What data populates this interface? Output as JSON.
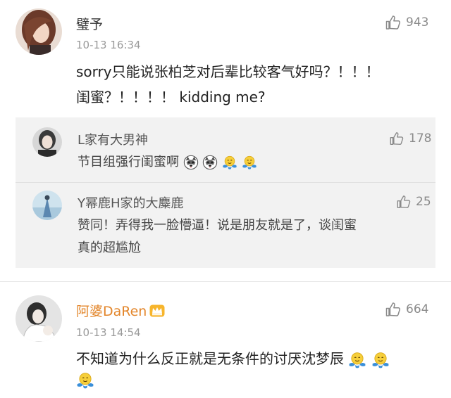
{
  "comments": [
    {
      "username": "璧予",
      "timestamp": "10-13 16:34",
      "likes": "943",
      "text_line1": "sorry只能说张柏芝对后辈比较客气好吗？！！！",
      "text_line2": "闺蜜？！！！！ kidding me?"
    },
    {
      "username": "阿婆DaRen",
      "timestamp": "10-13 14:54",
      "likes": "664",
      "text_line1": "不知道为什么反正就是无条件的讨厌沈梦辰"
    }
  ],
  "replies": [
    {
      "username": "L家有大男神",
      "likes": "178",
      "text": "节目组强行闺蜜啊"
    },
    {
      "username": "Y幂鹿H家的大麋鹿",
      "likes": "25",
      "text_line1": "赞同！弄得我一脸懵逼！说是朋友就是了，谈闺蜜",
      "text_line2": "真的超尴尬"
    }
  ],
  "colors": {
    "vip_name": "#e3862b",
    "reply_background": "#f2f2f2",
    "timestamp": "#9a9a9a"
  },
  "icons": [
    "thumbs-up-icon",
    "crown-icon",
    "husky-emoji",
    "hug-emoji"
  ]
}
